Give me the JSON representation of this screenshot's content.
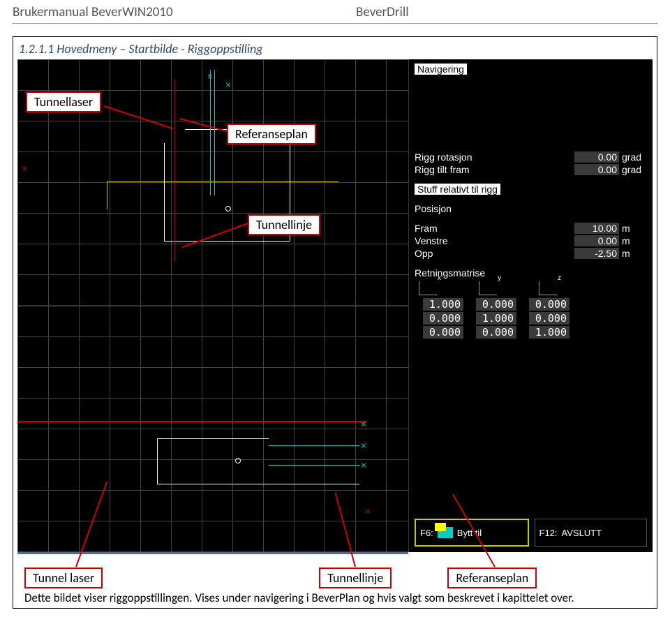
{
  "header": {
    "left": "Brukermanual BeverWIN2010",
    "right": "BeverDrill"
  },
  "heading": "1.2.1.1   Hovedmeny – Startbilde - Riggoppstilling",
  "callouts": {
    "tunnellaser_top": "Tunnellaser",
    "referanseplan_top": "Referanseplan",
    "tunnellinje_top": "Tunnellinje",
    "tunnel_laser_bot": "Tunnel laser",
    "tunnellinje_bot": "Tunnellinje",
    "referanseplan_bot": "Referanseplan"
  },
  "panel": {
    "nav_title": "Navigering",
    "rigg_rot_k": "Rigg rotasjon",
    "rigg_rot_v": "0.00",
    "grad": "grad",
    "rigg_tilt_k": "Rigg tilt fram",
    "rigg_tilt_v": "0.00",
    "stuff_title": "Stuff relativt til rigg",
    "pos_title": "Posisjon",
    "fram_k": "Fram",
    "fram_v": "10.00",
    "m": "m",
    "venstre_k": "Venstre",
    "venstre_v": "0.00",
    "opp_k": "Opp",
    "opp_v": "-2.50",
    "retn_title": "Retningsmatrise",
    "matrix": [
      [
        "1.000",
        "0.000",
        "0.000"
      ],
      [
        "0.000",
        "1.000",
        "0.000"
      ],
      [
        "0.000",
        "0.000",
        "1.000"
      ]
    ],
    "f6_label": "F6:",
    "f6_text": "Bytt til",
    "f12_label": "F12:",
    "f12_text": "AVSLUTT",
    "axis_x": "x",
    "axis_y": "y",
    "axis_z": "z"
  },
  "note": "Dette bildet viser riggoppstillingen. Vises under navigering i BeverPlan og hvis valgt som beskrevet i kapittelet over."
}
